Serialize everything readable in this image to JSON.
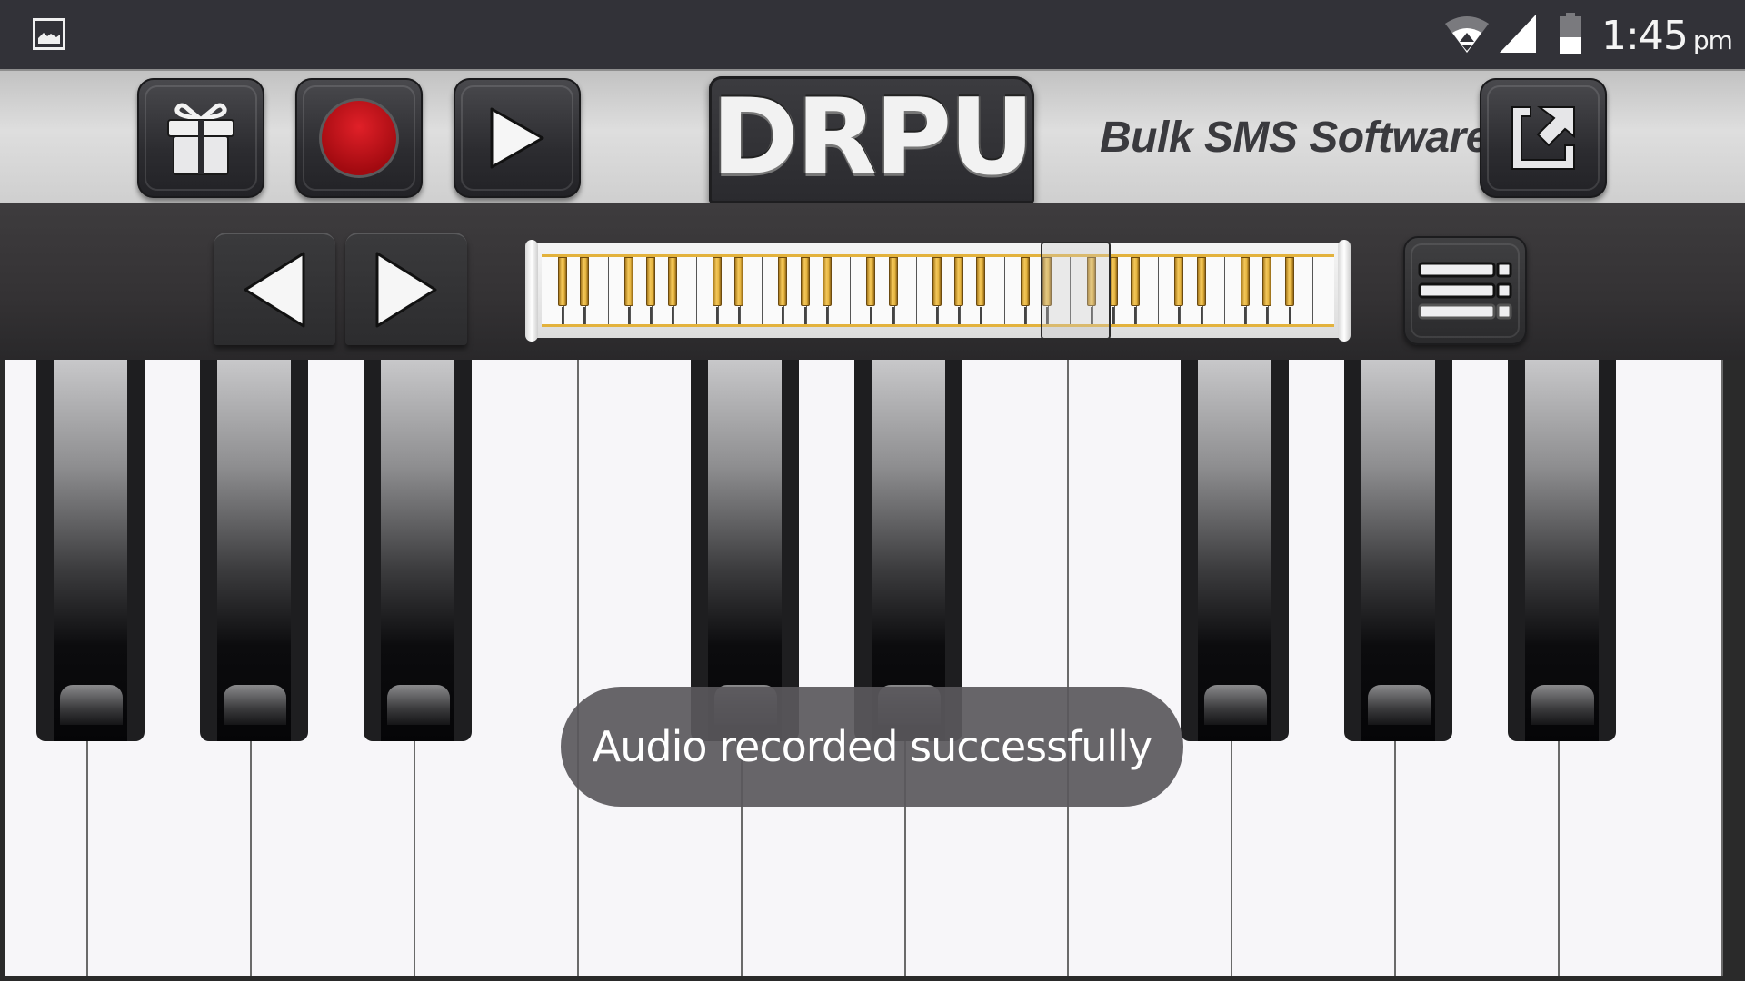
{
  "status_bar": {
    "time": "1:45",
    "ampm": "pm",
    "icons": [
      "gallery-notification-icon",
      "wifi-icon",
      "cell-signal-icon",
      "battery-icon"
    ]
  },
  "toolbar": {
    "buttons": [
      {
        "name": "gift",
        "icon": "gift-icon"
      },
      {
        "name": "record",
        "icon": "record-icon"
      },
      {
        "name": "play",
        "icon": "play-icon"
      },
      {
        "name": "share",
        "icon": "share-export-icon"
      }
    ],
    "logo": "DRPU",
    "tagline": "Bulk SMS Software",
    "colors": {
      "record": "#c4141c",
      "logo_bg": "#2e2e32"
    }
  },
  "controls": {
    "prev_icon": "triangle-left-icon",
    "next_icon": "triangle-right-icon",
    "menu_icon": "list-menu-icon",
    "keyboard_navigator": {
      "white_keys": 36,
      "visible_window_start_fraction": 0.63,
      "visible_window_white_keys": 11,
      "accent_color": "#e3b23c"
    }
  },
  "piano": {
    "white_key_count": 11,
    "black_key_groups": [
      3,
      2,
      3
    ],
    "white_color": "#f7f6f9",
    "black_color": "#0a0a0c"
  },
  "toast": {
    "message": "Audio recorded successfully"
  }
}
